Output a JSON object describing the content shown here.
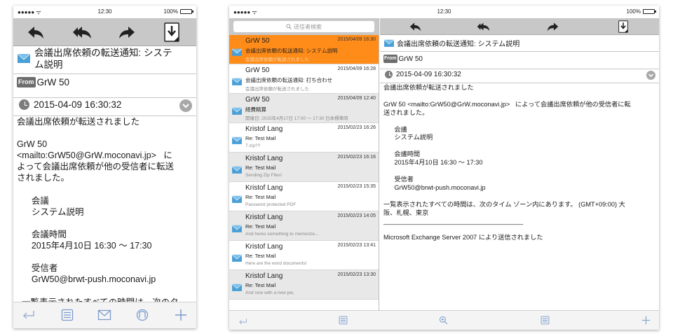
{
  "status": {
    "signal": "●●●●● ᯤ",
    "time": "12:30",
    "battery": "100%"
  },
  "message": {
    "subject": "会議出席依頼の転送通知: システム説明",
    "subject_line1": "会議出席依頼の転送通知: システ",
    "subject_line2": "ム説明",
    "from_badge": "From",
    "from_name": "GrW 50",
    "datetime": "2015-04-09 16:30:32",
    "phone_body": "会議出席依頼が転送されました\n\nGrW 50\n<mailto:GrW50@GrW.moconavi.jp>   に\nよって会議出席依頼が他の受信者に転送\nされました。\n\n      会議\n      システム説明\n\n      会議時間\n      2015年4月10日 16:30 〜 17:30\n\n      受信者\n      GrW50@brwt-push.moconavi.jp\n\n  一覧表示されたすべての時間は、次のタ",
    "tablet_body": "会議出席依頼が転送されました\n\nGrW 50 <mailto:GrW50@GrW.moconavi.jp>   によって会議出席依頼が他の受信者に転\n送されました。\n\n      会議\n      システム説明\n\n      会議時間\n      2015年4月10日 16:30 〜 17:30\n\n      受信者\n      GrW50@brwt-push.moconavi.jp\n\n一覧表示されたすべての時間は、次のタイム ゾーン内にあります。 (GMT+09:00) 大\n阪、札幌、東京\n_______________________________________\n\nMicrosoft Exchange Server 2007 により送信されました"
  },
  "search": {
    "placeholder": "送信者検索"
  },
  "mail_list": [
    {
      "sender": "GrW 50",
      "date": "2015/04/09 16:30",
      "subject": "会議出席依頼の転送通知: システム説明",
      "preview": "会議出席依頼が転送されました",
      "style": "selected"
    },
    {
      "sender": "GrW 50",
      "date": "2015/04/09 16:28",
      "subject": "会議出席依頼の転送通知: 打ち合わせ",
      "preview": "会議出席依頼が転送されました",
      "style": "white"
    },
    {
      "sender": "GrW 50",
      "date": "2015/04/09 12:40",
      "subject": "経費精算",
      "preview": "開催日: 2015年4月17日 17:00 〜 17:30 日本標準時",
      "style": "gray"
    },
    {
      "sender": "Kristof Lang",
      "date": "2015/02/23 16:26",
      "subject": "Re: Test Mail",
      "preview": "7-zip??",
      "style": "white"
    },
    {
      "sender": "Kristof Lang",
      "date": "2015/02/23 16:16",
      "subject": "Re: Test Mail",
      "preview": "Sending Zip Files!",
      "style": "gray"
    },
    {
      "sender": "Kristof Lang",
      "date": "2015/02/23 15:35",
      "subject": "Re: Test Mail",
      "preview": "Password protected PDF",
      "style": "white"
    },
    {
      "sender": "Kristof Lang",
      "date": "2015/02/23 14:05",
      "subject": "Re: Test Mail",
      "preview": "And heres something to memorize...",
      "style": "gray"
    },
    {
      "sender": "Kristof Lang",
      "date": "2015/02/23 13:41",
      "subject": "Re: Test Mail",
      "preview": "Here are the word documents!",
      "style": "white"
    },
    {
      "sender": "Kristof Lang",
      "date": "2015/02/23 13:30",
      "subject": "Re: Test Mail",
      "preview": "And now with a new pw,",
      "style": "gray"
    },
    {
      "sender": "",
      "date": "",
      "subject": "",
      "preview": "",
      "style": "white"
    }
  ],
  "icons": {
    "reply": "reply-icon",
    "reply_all": "reply-all-icon",
    "forward": "forward-icon",
    "download": "download-icon",
    "back": "back-arrow-icon",
    "list": "list-icon",
    "mail": "mail-icon",
    "folder": "folder-icon",
    "add": "plus-icon",
    "zoom": "zoom-in-icon",
    "search": "search-icon"
  },
  "colors": {
    "selected": "#ff8c19",
    "toolbar": "#c8c8c8",
    "envelope": "#4a9fd6",
    "bottom_icon": "#9db3d6"
  }
}
